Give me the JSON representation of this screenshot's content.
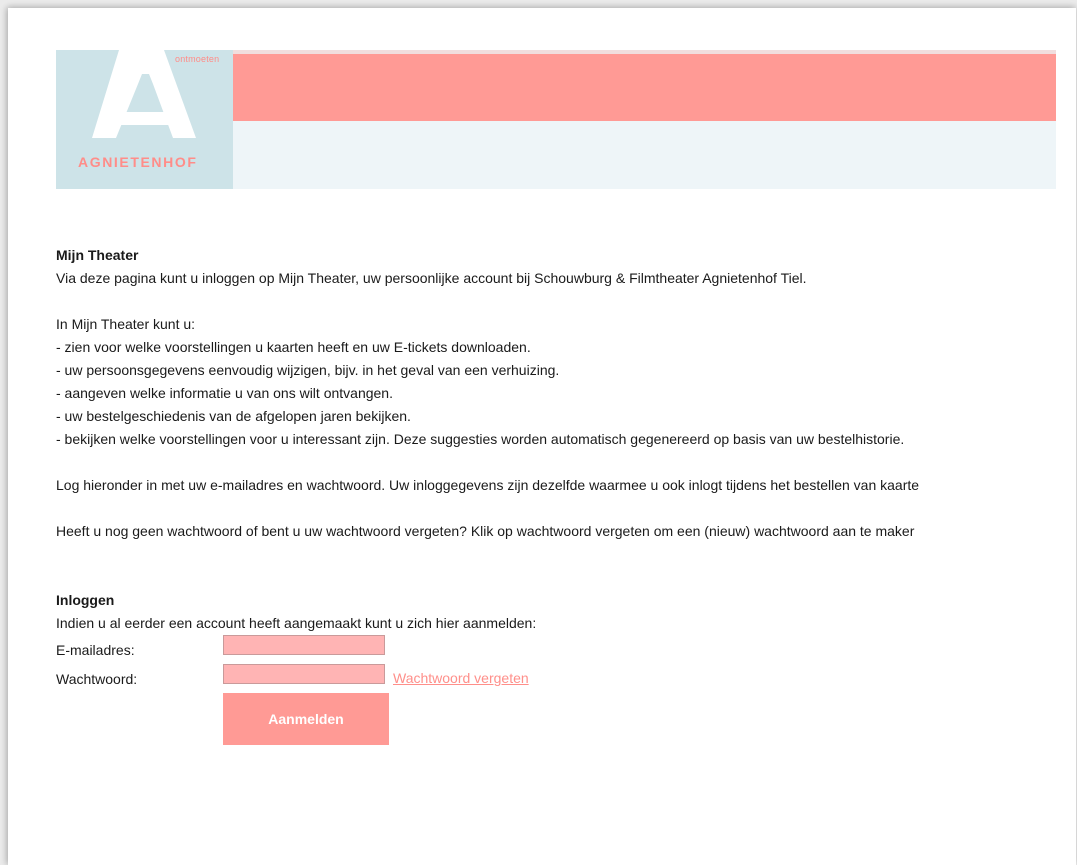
{
  "header": {
    "logo_tagline": "ontmoeten",
    "logo_name": "AGNIETENHOF"
  },
  "intro": {
    "title": "Mijn Theater",
    "lead": "Via deze pagina kunt u inloggen op Mijn Theater, uw persoonlijke account bij Schouwburg & Filmtheater Agnietenhof Tiel.",
    "list_intro": "In Mijn Theater kunt u:",
    "items": [
      "- zien voor welke voorstellingen u kaarten heeft en uw E-tickets downloaden.",
      "- uw persoonsgegevens eenvoudig wijzigen, bijv. in het geval van een verhuizing.",
      "- aangeven welke informatie u van ons wilt ontvangen.",
      "- uw bestelgeschiedenis van de afgelopen jaren bekijken.",
      "- bekijken welke voorstellingen voor u interessant zijn. Deze suggesties worden automatisch gegenereerd op basis van uw bestelhistorie."
    ],
    "login_info": "Log hieronder in met uw e-mailadres en wachtwoord. Uw inloggegevens zijn dezelfde waarmee u ook inlogt tijdens het bestellen van kaarte",
    "password_info": "Heeft u nog geen wachtwoord of bent u uw wachtwoord vergeten? Klik op wachtwoord vergeten om een (nieuw) wachtwoord aan te maker"
  },
  "login": {
    "title": "Inloggen",
    "subtitle": "Indien u al eerder een account heeft aangemaakt kunt u zich hier aanmelden:",
    "email_label": "E-mailadres:",
    "email_value": "",
    "password_label": "Wachtwoord:",
    "password_value": "",
    "forgot_label": "Wachtwoord vergeten",
    "submit_label": "Aanmelden"
  },
  "colors": {
    "accent": "#ff9a95",
    "input_bg": "#ffb4b4",
    "logo_bg": "#cde3e8",
    "banner_light": "#eef5f8"
  },
  "icons": {
    "logo": "agnietenhof-a-logo"
  }
}
